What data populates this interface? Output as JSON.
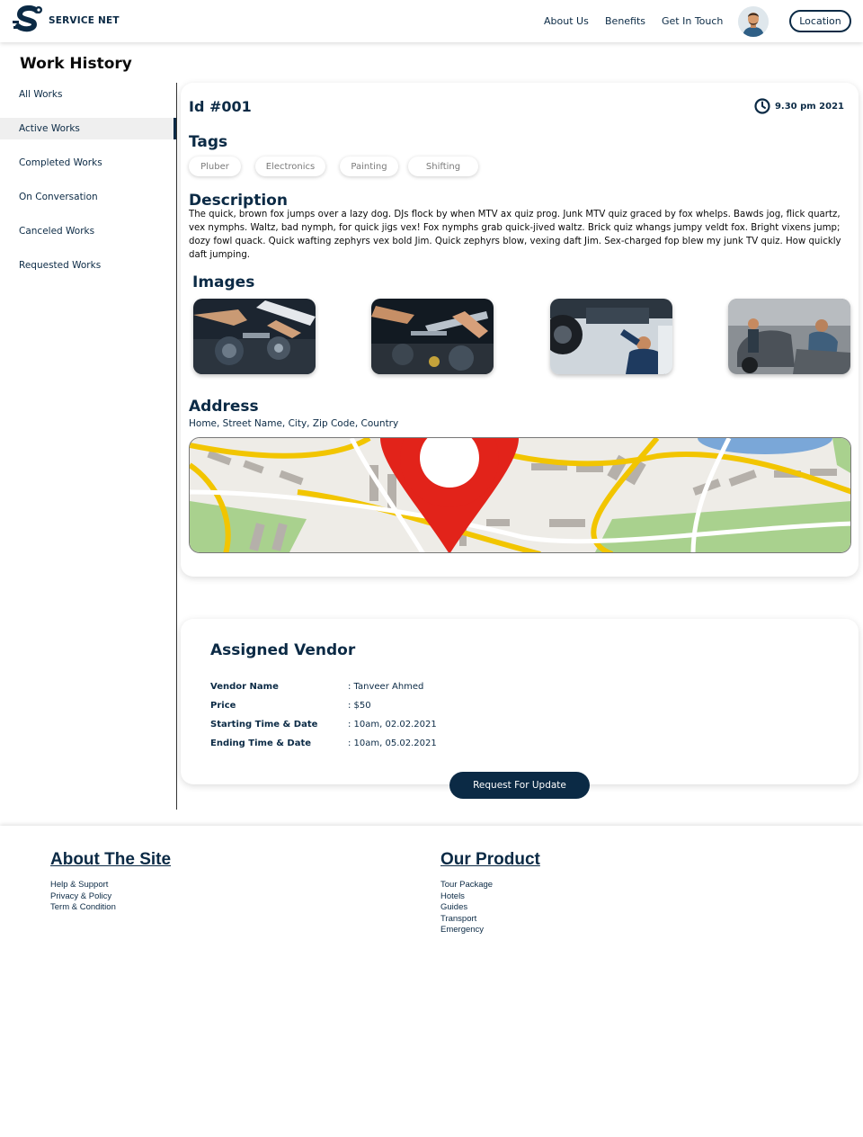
{
  "brand": {
    "name": "SERVICE NET"
  },
  "nav": {
    "about": "About Us",
    "benefits": "Benefits",
    "contact": "Get In Touch",
    "location_button": "Location"
  },
  "page_title": "Work History",
  "sidebar": {
    "items": [
      {
        "label": "All Works"
      },
      {
        "label": "Active Works"
      },
      {
        "label": "Completed Works"
      },
      {
        "label": "On Conversation"
      },
      {
        "label": "Canceled Works"
      },
      {
        "label": "Requested Works"
      }
    ],
    "active_index": 1
  },
  "work": {
    "id": "Id #001",
    "time": "9.30 pm 2021",
    "tags_heading": "Tags",
    "tags": [
      "Pluber",
      "Electronics",
      "Painting",
      "Shifting"
    ],
    "description_heading": "Description",
    "description": "The quick, brown fox jumps over a lazy dog. DJs flock by when MTV ax quiz prog. Junk MTV quiz graced by fox whelps. Bawds jog, flick quartz, vex nymphs. Waltz, bad nymph, for quick jigs vex! Fox nymphs grab quick-jived waltz. Brick quiz whangs jumpy veldt fox. Bright vixens jump; dozy fowl quack. Quick wafting zephyrs vex bold Jim. Quick zephyrs blow, vexing daft Jim. Sex-charged fop blew my junk TV quiz. How quickly daft jumping.",
    "images_heading": "Images",
    "address_heading": "Address",
    "address": "Home, Street Name, City, Zip Code, Country"
  },
  "vendor": {
    "heading": "Assigned Vendor",
    "rows": [
      {
        "label": "Vendor Name",
        "value": ": Tanveer Ahmed"
      },
      {
        "label": "Price",
        "value": ": $50"
      },
      {
        "label": "Starting Time & Date",
        "value": ": 10am, 02.02.2021"
      },
      {
        "label": "Ending Time & Date",
        "value": ": 10am, 05.02.2021"
      }
    ],
    "request_button": "Request For Update"
  },
  "footer": {
    "about": {
      "title": "About The Site",
      "links": [
        "Help & Support",
        "Privacy & Policy",
        "Term & Condition"
      ]
    },
    "product": {
      "title": "Our Product",
      "links": [
        "Tour Package",
        "Hotels",
        "Guides",
        "Transport",
        "Emergency"
      ]
    }
  },
  "colors": {
    "primary": "#0b2a45",
    "pin": "#e2231a",
    "road": "#f2c500",
    "park": "#a9d18e"
  }
}
